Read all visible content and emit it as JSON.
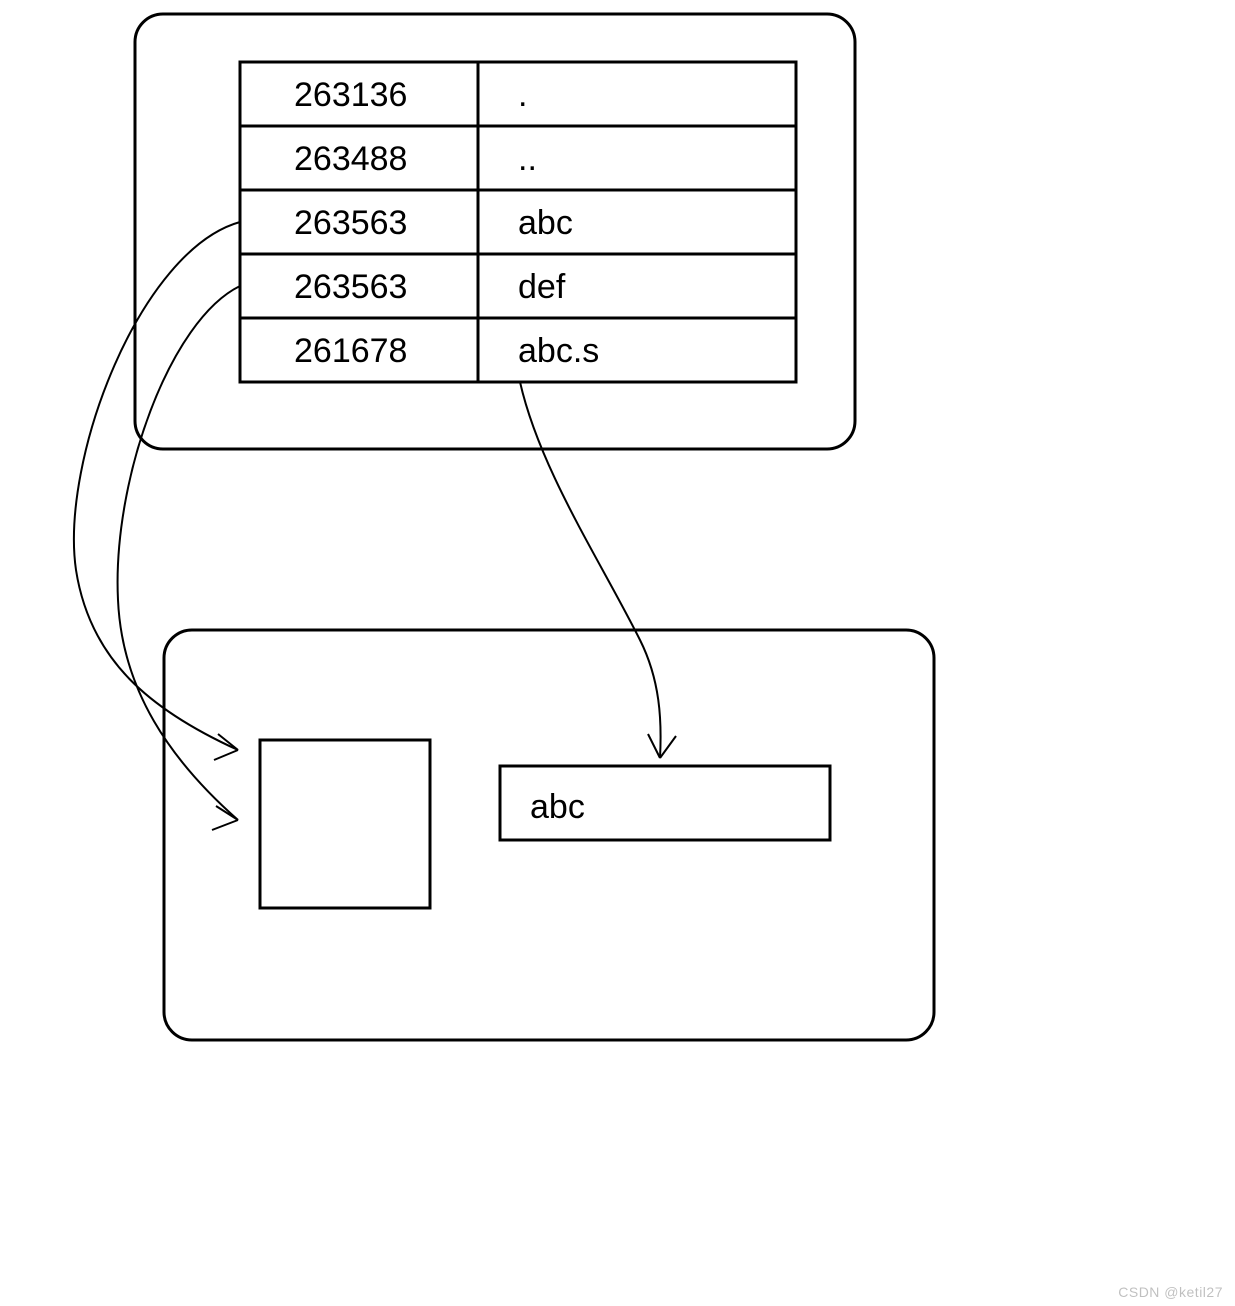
{
  "diagram": {
    "directory_table": {
      "rows": [
        {
          "inode": "263136",
          "name": "."
        },
        {
          "inode": "263488",
          "name": ".."
        },
        {
          "inode": "263563",
          "name": "abc"
        },
        {
          "inode": "263563",
          "name": "def"
        },
        {
          "inode": "261678",
          "name": "abc.s"
        }
      ]
    },
    "target_label": "abc"
  },
  "watermark": "CSDN @ketil27"
}
